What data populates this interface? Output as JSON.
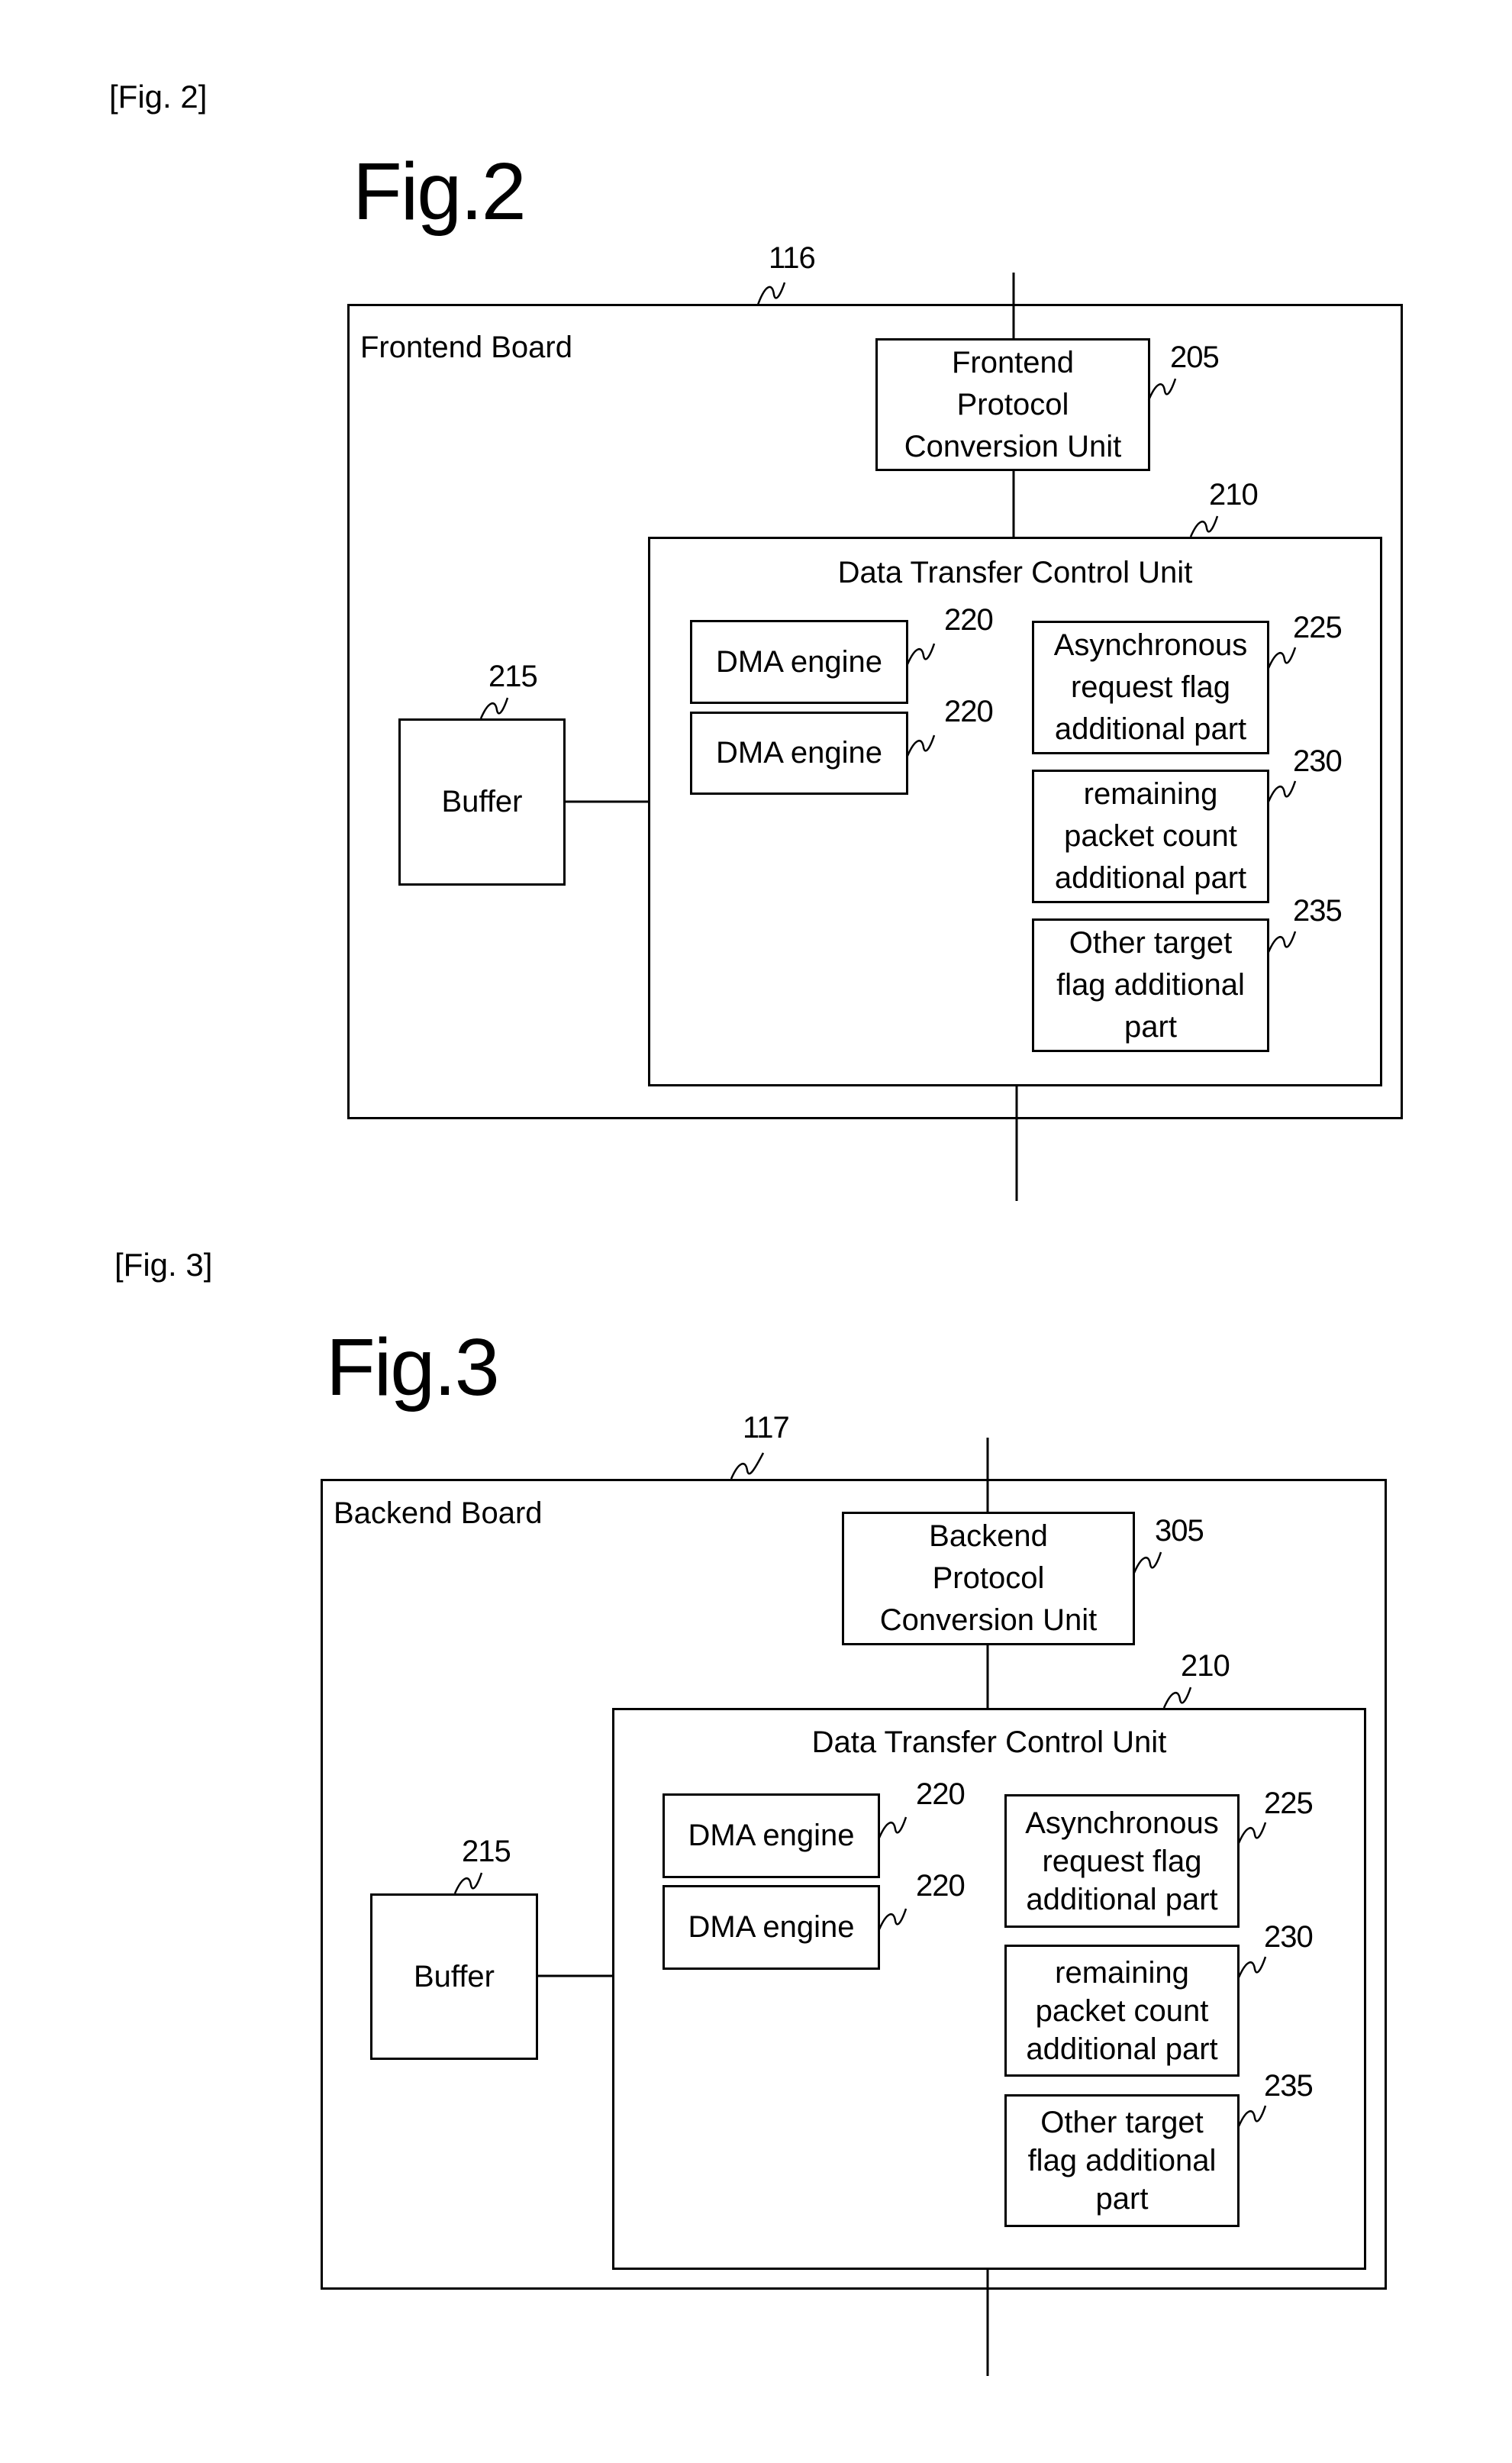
{
  "figures": [
    {
      "tag": "[Fig. 2]",
      "title": "Fig.2",
      "board": {
        "label": "Frontend Board",
        "ref": "116"
      },
      "protocol_unit": {
        "lines": [
          "Frontend",
          "Protocol",
          "Conversion Unit"
        ],
        "ref": "205"
      },
      "dtcu": {
        "label": "Data Transfer Control Unit",
        "ref": "210"
      },
      "buffer": {
        "label": "Buffer",
        "ref": "215"
      },
      "dma_engines": [
        {
          "label": "DMA engine",
          "ref": "220"
        },
        {
          "label": "DMA engine",
          "ref": "220"
        }
      ],
      "parts": [
        {
          "lines": [
            "Asynchronous",
            "request flag",
            "additional part"
          ],
          "ref": "225"
        },
        {
          "lines": [
            "remaining",
            "packet count",
            "additional part"
          ],
          "ref": "230"
        },
        {
          "lines": [
            "Other target",
            "flag additional",
            "part"
          ],
          "ref": "235"
        }
      ]
    },
    {
      "tag": "[Fig. 3]",
      "title": "Fig.3",
      "board": {
        "label": "Backend Board",
        "ref": "117"
      },
      "protocol_unit": {
        "lines": [
          "Backend",
          "Protocol",
          "Conversion Unit"
        ],
        "ref": "305"
      },
      "dtcu": {
        "label": "Data Transfer Control Unit",
        "ref": "210"
      },
      "buffer": {
        "label": "Buffer",
        "ref": "215"
      },
      "dma_engines": [
        {
          "label": "DMA engine",
          "ref": "220"
        },
        {
          "label": "DMA engine",
          "ref": "220"
        }
      ],
      "parts": [
        {
          "lines": [
            "Asynchronous",
            "request flag",
            "additional part"
          ],
          "ref": "225"
        },
        {
          "lines": [
            "remaining",
            "packet count",
            "additional part"
          ],
          "ref": "230"
        },
        {
          "lines": [
            "Other target",
            "flag additional",
            "part"
          ],
          "ref": "235"
        }
      ]
    }
  ]
}
